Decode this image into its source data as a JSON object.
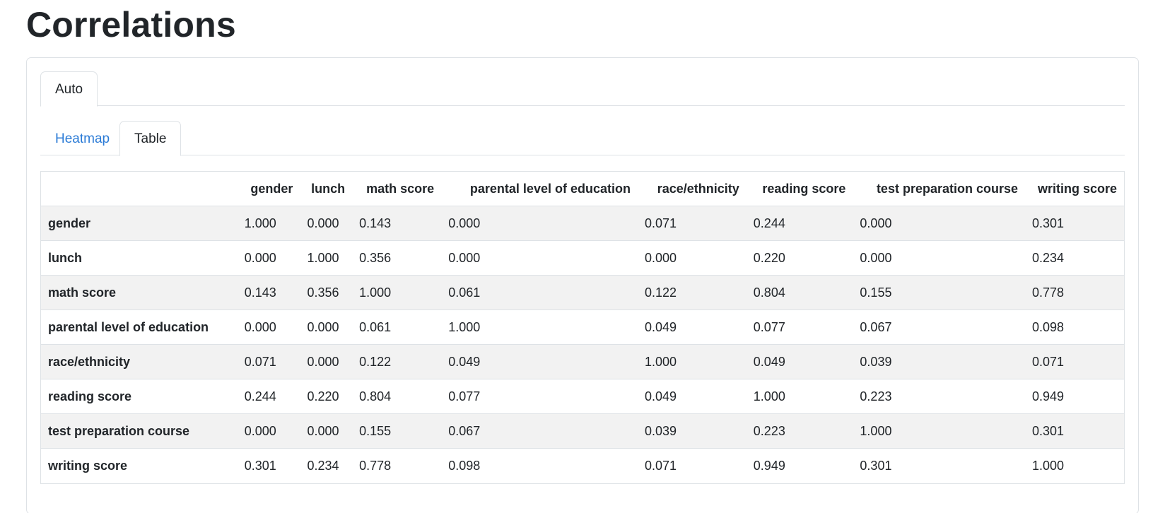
{
  "page": {
    "title": "Correlations"
  },
  "tabs": {
    "outer": [
      {
        "label": "Auto",
        "active": true
      }
    ],
    "inner": [
      {
        "label": "Heatmap",
        "active": false
      },
      {
        "label": "Table",
        "active": true
      }
    ]
  },
  "table": {
    "columns": [
      "",
      "gender",
      "lunch",
      "math score",
      "parental level of education",
      "race/ethnicity",
      "reading score",
      "test preparation course",
      "writing score"
    ],
    "rows": [
      {
        "label": "gender",
        "values": [
          "1.000",
          "0.000",
          "0.143",
          "0.000",
          "0.071",
          "0.244",
          "0.000",
          "0.301"
        ]
      },
      {
        "label": "lunch",
        "values": [
          "0.000",
          "1.000",
          "0.356",
          "0.000",
          "0.000",
          "0.220",
          "0.000",
          "0.234"
        ]
      },
      {
        "label": "math score",
        "values": [
          "0.143",
          "0.356",
          "1.000",
          "0.061",
          "0.122",
          "0.804",
          "0.155",
          "0.778"
        ]
      },
      {
        "label": "parental level of education",
        "values": [
          "0.000",
          "0.000",
          "0.061",
          "1.000",
          "0.049",
          "0.077",
          "0.067",
          "0.098"
        ]
      },
      {
        "label": "race/ethnicity",
        "values": [
          "0.071",
          "0.000",
          "0.122",
          "0.049",
          "1.000",
          "0.049",
          "0.039",
          "0.071"
        ]
      },
      {
        "label": "reading score",
        "values": [
          "0.244",
          "0.220",
          "0.804",
          "0.077",
          "0.049",
          "1.000",
          "0.223",
          "0.949"
        ]
      },
      {
        "label": "test preparation course",
        "values": [
          "0.000",
          "0.000",
          "0.155",
          "0.067",
          "0.039",
          "0.223",
          "1.000",
          "0.301"
        ]
      },
      {
        "label": "writing score",
        "values": [
          "0.301",
          "0.234",
          "0.778",
          "0.098",
          "0.071",
          "0.949",
          "0.301",
          "1.000"
        ]
      }
    ]
  },
  "colors": {
    "link": "#2b7bd6",
    "border": "#dee2e6",
    "stripe": "#f2f2f2",
    "text": "#212529"
  }
}
